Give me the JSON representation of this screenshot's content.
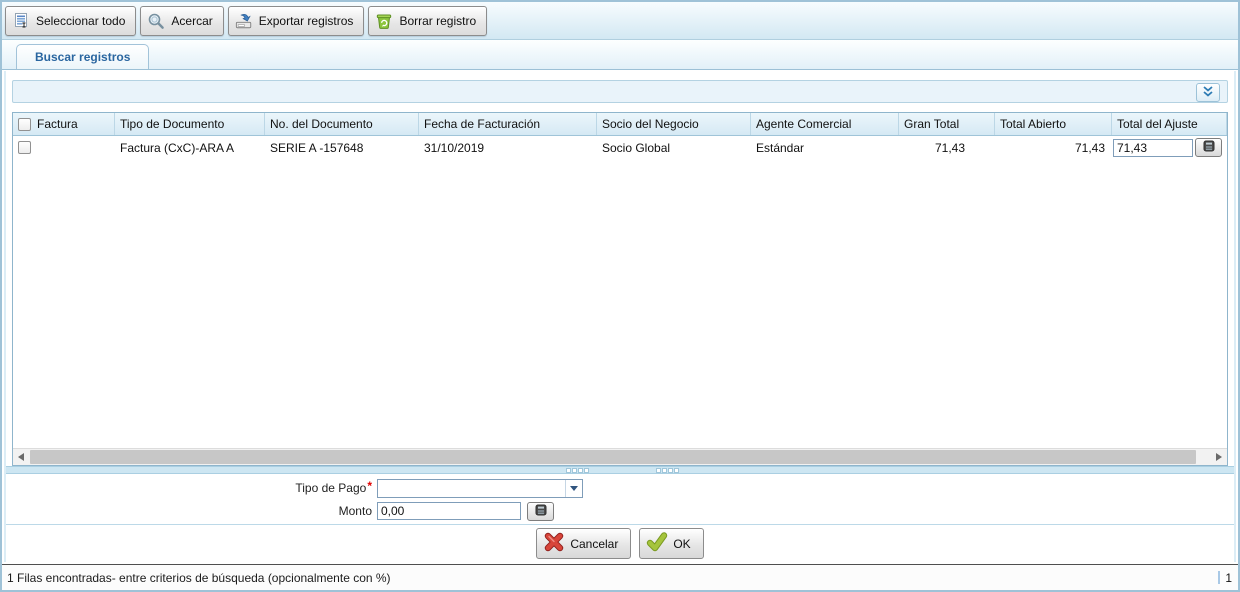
{
  "toolbar": {
    "buttons": [
      {
        "id": "select-all",
        "label": "Seleccionar todo",
        "icon": "select-all-icon"
      },
      {
        "id": "zoom-in",
        "label": "Acercar",
        "icon": "magnifier-icon"
      },
      {
        "id": "export",
        "label": "Exportar registros",
        "icon": "export-disk-icon"
      },
      {
        "id": "delete",
        "label": "Borrar registro",
        "icon": "green-trash-icon"
      }
    ]
  },
  "tab": {
    "label": "Buscar registros"
  },
  "filter_panel": {
    "collapsed": true,
    "expand_icon": "chevron-double-down-icon"
  },
  "table": {
    "columns": [
      "Factura",
      "Tipo de Documento",
      "No. del Documento",
      "Fecha de Facturación",
      "Socio del Negocio",
      "Agente Comercial",
      "Gran Total",
      "Total Abierto",
      "Total del Ajuste"
    ],
    "rows": [
      {
        "checked": false,
        "tipo_de_documento": "Factura (CxC)-ARA A",
        "no_del_documento": "SERIE A -157648",
        "fecha_de_facturacion": "31/10/2019",
        "socio_del_negocio": "Socio Global",
        "agente_comercial": "Estándar",
        "gran_total": "71,43",
        "total_abierto": "71,43",
        "total_del_ajuste": "71,43"
      }
    ]
  },
  "form": {
    "tipo_de_pago": {
      "label": "Tipo de Pago",
      "required_marker": "*",
      "value": ""
    },
    "monto": {
      "label": "Monto",
      "value": "0,00"
    },
    "buttons": {
      "cancel": "Cancelar",
      "ok": "OK"
    }
  },
  "status_bar": {
    "message": "1 Filas encontradas- entre criterios de búsqueda (opcionalmente con %)",
    "page": "1"
  },
  "icons": {
    "amount_editor": "calculator-icon",
    "cancel": "red-x-icon",
    "ok": "green-check-icon",
    "combo": "dropdown-arrow-icon"
  },
  "colors": {
    "accent_blue": "#2a66a0",
    "frame_blue": "#9fc2d7",
    "header_bg": "#d5e9f4",
    "required_red": "#e00000",
    "trash_green": "#8dc63f",
    "cancel_red": "#cc3328",
    "ok_green": "#9ec439"
  }
}
